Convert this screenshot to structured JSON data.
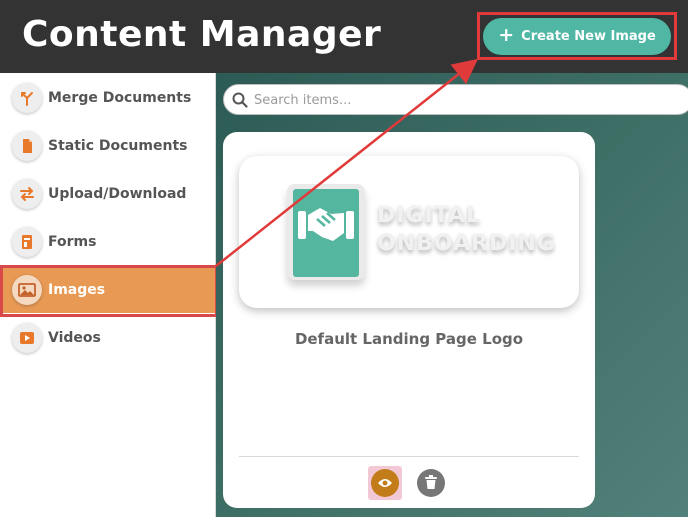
{
  "header": {
    "title": "Content Manager",
    "create_button": {
      "icon": "plus-icon",
      "label": "Create New Image"
    }
  },
  "sidebar": {
    "items": [
      {
        "label": "Merge Documents",
        "icon": "merge-icon",
        "active": false
      },
      {
        "label": "Static Documents",
        "icon": "document-icon",
        "active": false
      },
      {
        "label": "Upload/Download",
        "icon": "transfer-icon",
        "active": false
      },
      {
        "label": "Forms",
        "icon": "form-icon",
        "active": false
      },
      {
        "label": "Images",
        "icon": "image-icon",
        "active": true
      },
      {
        "label": "Videos",
        "icon": "video-icon",
        "active": false
      }
    ]
  },
  "search": {
    "placeholder": "Search items..."
  },
  "cards": [
    {
      "title": "Default Landing Page Logo",
      "preview_text": [
        "DIGITAL",
        "ONBOARDING"
      ],
      "actions": [
        {
          "name": "view",
          "icon": "eye-icon"
        },
        {
          "name": "delete",
          "icon": "trash-icon"
        }
      ]
    }
  ],
  "colors": {
    "header_bg": "#333333",
    "accent_teal": "#4fb7a3",
    "active_orange": "#e89a55",
    "annotation_red": "#e03a3a",
    "view_button": "#c27c19",
    "delete_button": "#777777"
  }
}
